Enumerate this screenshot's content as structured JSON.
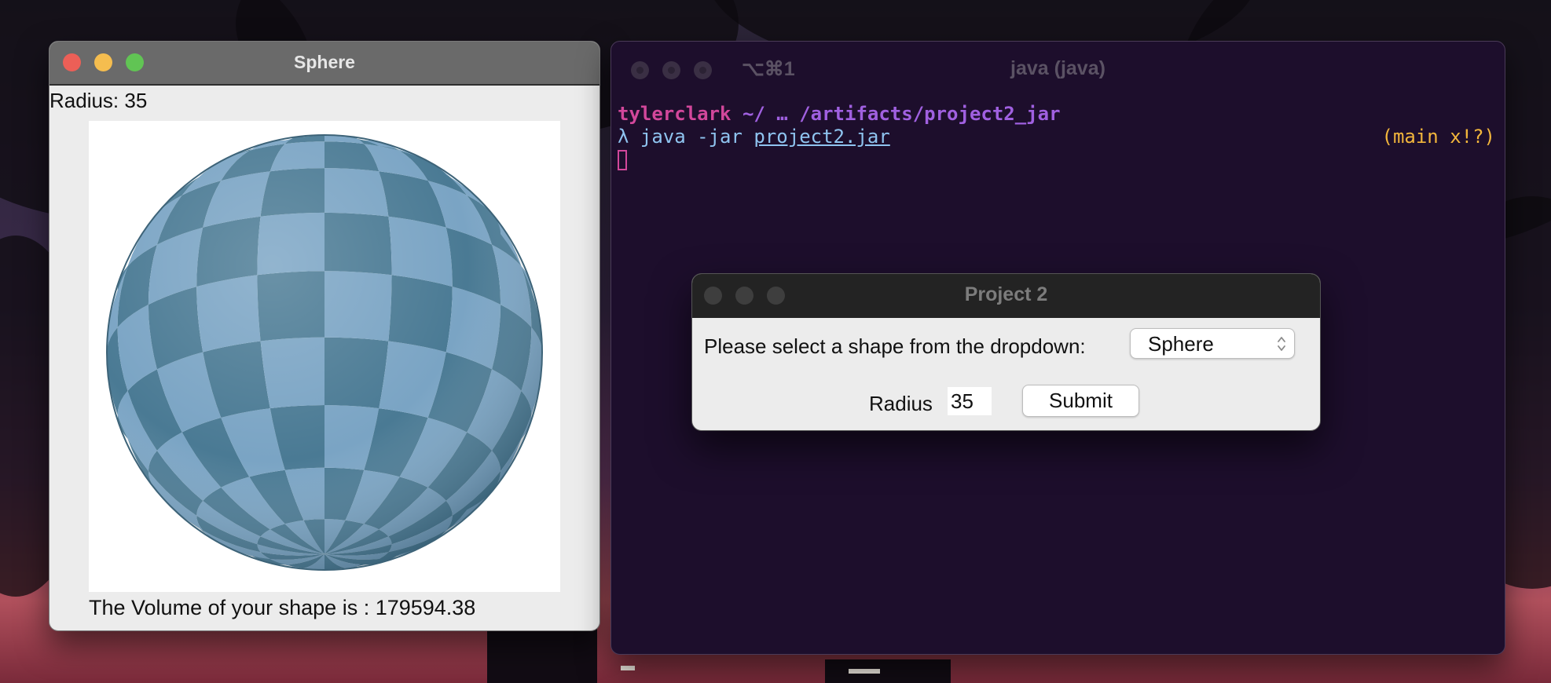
{
  "sphere_window": {
    "title": "Sphere",
    "radius_label": "Radius: 35",
    "volume_label": "The Volume of your shape is : 179594.38",
    "traffic_colors": {
      "close": "#ec5f57",
      "minimize": "#f5bd4f",
      "maximize": "#61c454"
    },
    "sphere_colors": {
      "light": "#7aa4c4",
      "dark": "#4a7a94"
    }
  },
  "terminal": {
    "shortcut": "⌥⌘1",
    "title": "java (java)",
    "user": "tylerclark",
    "path": "~/ … /artifacts/project2_jar",
    "prompt_symbol": "λ",
    "command": "java -jar",
    "command_file": "project2.jar",
    "git_status": "(main x!?)",
    "colors": {
      "background": "#1d0e2c",
      "user": "#d2479b",
      "path": "#a060e0",
      "command": "#8fc4f0",
      "git": "#f2b63c"
    }
  },
  "dialog": {
    "title": "Project 2",
    "prompt": "Please select a shape from the dropdown:",
    "shape_select_value": "Sphere",
    "radius_label": "Radius",
    "radius_value": "35",
    "submit_label": "Submit"
  }
}
